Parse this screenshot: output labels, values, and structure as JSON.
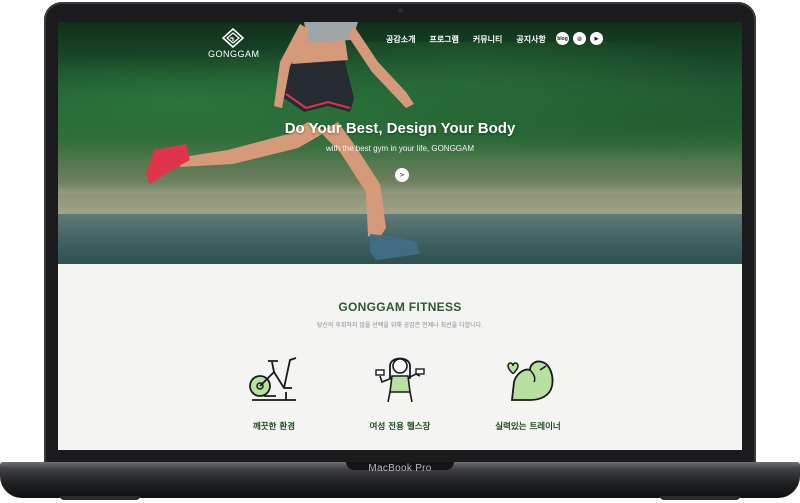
{
  "device": {
    "label": "MacBook Pro"
  },
  "site": {
    "logo_text": "GONGGAM",
    "nav": [
      {
        "label": "공감소개"
      },
      {
        "label": "프로그램"
      },
      {
        "label": "커뮤니티"
      },
      {
        "label": "공지사항"
      }
    ],
    "social": [
      {
        "icon": "blog-icon",
        "text": "blog"
      },
      {
        "icon": "instagram-icon",
        "text": "◎"
      },
      {
        "icon": "youtube-icon",
        "text": "▶"
      }
    ]
  },
  "hero": {
    "title": "Do Your Best, Design Your Body",
    "subtitle": "with the best gym in your life, GONGGAM",
    "next_button": ">"
  },
  "intro": {
    "title": "GONGGAM FITNESS",
    "description": "당신의 후회하지 않을 선택을 위해 공감은 언제나 최선을 다합니다."
  },
  "features": [
    {
      "icon": "exercise-bike-icon",
      "label": "깨끗한 환경"
    },
    {
      "icon": "woman-dumbbell-icon",
      "label": "여성 전용 헬스장"
    },
    {
      "icon": "flexed-arm-heart-icon",
      "label": "실력있는 트레이너"
    }
  ],
  "colors": {
    "accent_green": "#2b5b2d",
    "feature_icon_fill": "#b8e0a0",
    "section_bg": "#f4f4f3"
  }
}
